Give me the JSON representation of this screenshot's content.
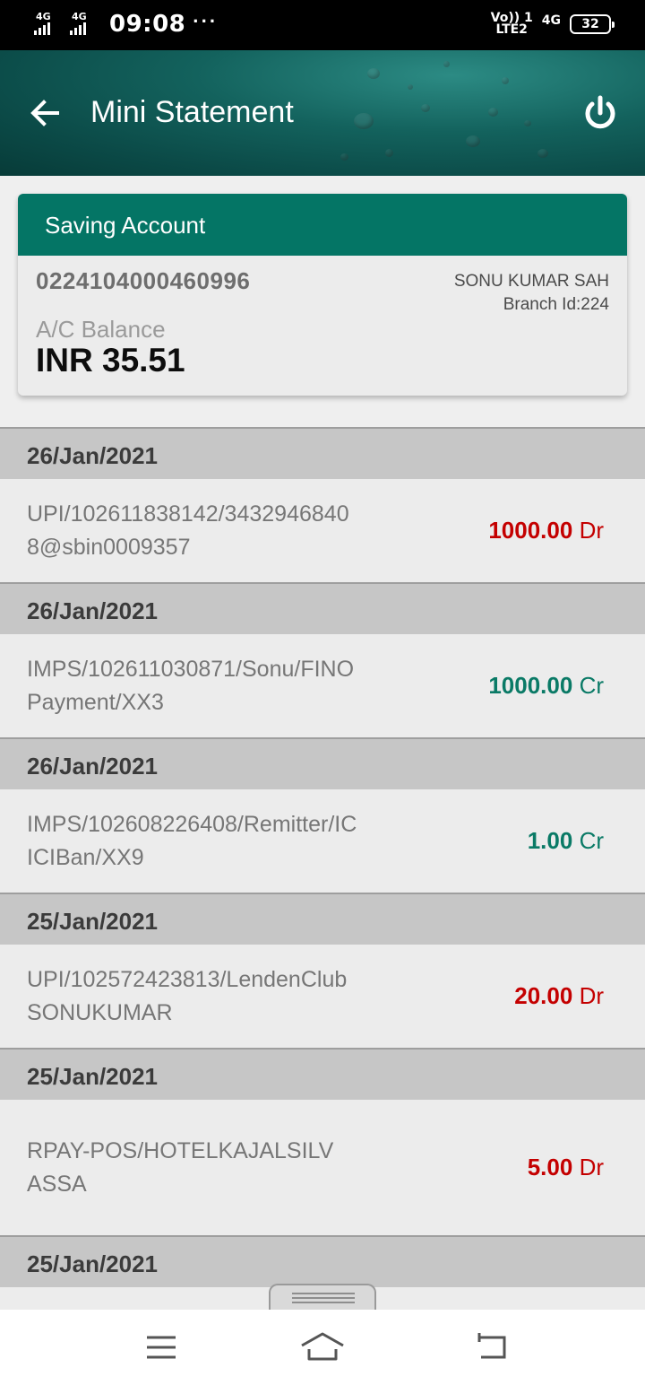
{
  "status_bar": {
    "sim1_network": "4G",
    "sim2_network": "4G",
    "time": "09:08",
    "notification_dots": "···",
    "volte_line1": "Vo)) 1",
    "volte_line2": "LTE2",
    "data_network": "4G",
    "battery_level": "32"
  },
  "header": {
    "title": "Mini Statement",
    "back_icon": "arrow-left-icon",
    "power_icon": "power-icon",
    "background_color": "#0f5e5a"
  },
  "account": {
    "type_label": "Saving Account",
    "number": "0224104000460996",
    "holder_name": "SONU KUMAR SAH",
    "branch": "Branch Id:224",
    "balance_label": "A/C Balance",
    "balance": "INR 35.51",
    "accent_color": "#047565"
  },
  "transactions": [
    {
      "date": "26/Jan/2021",
      "description": "UPI/102611838142/34329468408@sbin0009357",
      "amount": "1000.00",
      "type": "Dr"
    },
    {
      "date": "26/Jan/2021",
      "description": "IMPS/102611030871/Sonu/FINOPayment/XX3",
      "amount": "1000.00",
      "type": "Cr"
    },
    {
      "date": "26/Jan/2021",
      "description": "IMPS/102608226408/Remitter/ICICIBan/XX9",
      "amount": "1.00",
      "type": "Cr"
    },
    {
      "date": "25/Jan/2021",
      "description": "UPI/102572423813/LendenClubSONUKUMAR",
      "amount": "20.00",
      "type": "Dr"
    },
    {
      "date": "25/Jan/2021",
      "description": "RPAY-POS/HOTELKAJALSILVASSA",
      "amount": "5.00",
      "type": "Dr"
    },
    {
      "date": "25/Jan/2021"
    }
  ],
  "colors": {
    "debit": "#c40000",
    "credit": "#0a7a66"
  },
  "nav_bar": {
    "menu_icon": "menu-icon",
    "home_icon": "home-icon",
    "back_icon": "back-icon"
  }
}
